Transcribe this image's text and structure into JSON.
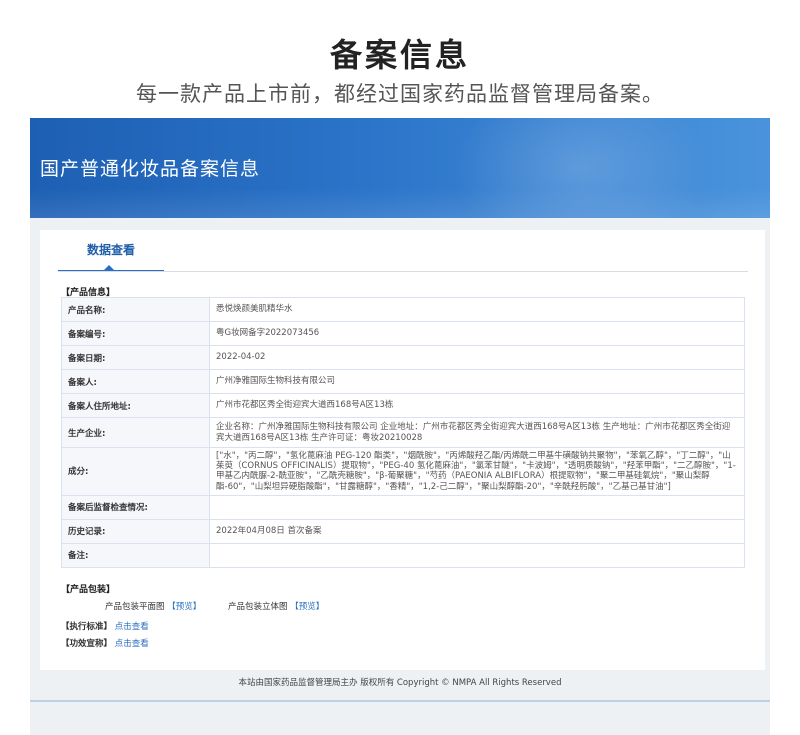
{
  "hero": {
    "title": "备案信息",
    "subtitle": "每一款产品上市前，都经过国家药品监督管理局备案。"
  },
  "banner": {
    "title": "国产普通化妆品备案信息"
  },
  "tab": {
    "label": "数据查看"
  },
  "product_info": {
    "section_label": "【产品信息】",
    "rows": [
      {
        "key": "产品名称:",
        "value": "悉悦焕颜美肌精华水"
      },
      {
        "key": "备案编号:",
        "value": "粤G妆网备字2022073456"
      },
      {
        "key": "备案日期:",
        "value": "2022-04-02"
      },
      {
        "key": "备案人:",
        "value": "广州净雅国际生物科技有限公司"
      },
      {
        "key": "备案人住所地址:",
        "value": "广州市花都区秀全街迎宾大道西168号A区13栋"
      },
      {
        "key": "生产企业:",
        "value": "企业名称：广州净雅国际生物科技有限公司 企业地址：广州市花都区秀全街迎宾大道西168号A区13栋 生产地址：广州市花都区秀全街迎宾大道西168号A区13栋 生产许可证：粤妆20210028"
      },
      {
        "key": "成分:",
        "value": "[\"水\"，\"丙二醇\"，\"氢化蓖麻油 PEG-120 酯类\"，\"烟酰胺\"，\"丙烯酸羟乙酯/丙烯酰二甲基牛磺酸钠共聚物\"，\"苯氧乙醇\"，\"丁二醇\"，\"山茱萸（CORNUS OFFICINALIS）提取物\"，\"PEG-40 氢化蓖麻油\"，\"氯苯甘醚\"，\"卡波姆\"，\"透明质酸钠\"，\"羟苯甲酯\"，\"二乙醇胺\"，\"1-甲基乙内酰脲-2-酰亚胺\"，\"乙酰壳糖胺\"，\"β-葡聚糖\"，\"芍药（PAEONIA ALBIFLORA）根提取物\"，\"聚二甲基硅氧烷\"，\"聚山梨醇酯-60\"，\"山梨坦异硬脂酸酯\"，\"甘露糖醇\"，\"香精\"，\"1,2-己二醇\"，\"聚山梨醇酯-20\"，\"辛酰羟肟酸\"，\"乙基己基甘油\"]"
      },
      {
        "key": "备案后监督检查情况:",
        "value": ""
      },
      {
        "key": "历史记录:",
        "value": "2022年04月08日 首次备案"
      },
      {
        "key": "备注:",
        "value": ""
      }
    ]
  },
  "packaging": {
    "section_label": "【产品包装】",
    "flat_label": "产品包装平面图",
    "flat_preview": "【预览】",
    "solid_label": "产品包装立体图",
    "solid_preview": "【预览】"
  },
  "standard": {
    "label": "【执行标准】",
    "link": "点击查看"
  },
  "efficacy": {
    "label": "【功效宣称】",
    "link": "点击查看"
  },
  "footer": {
    "text": "本站由国家药品监督管理局主办 版权所有 Copyright © NMPA All Rights Reserved"
  }
}
